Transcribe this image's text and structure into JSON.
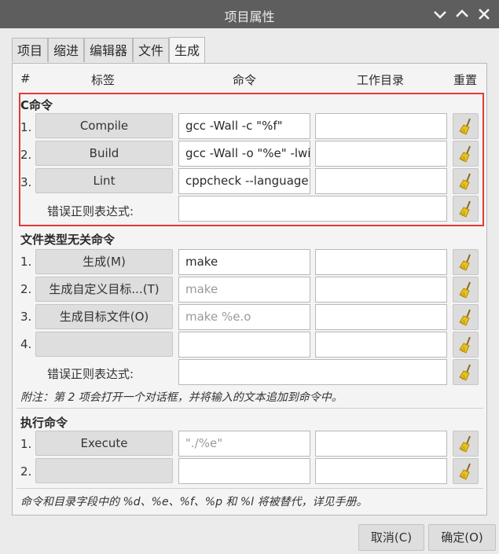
{
  "window": {
    "title": "项目属性"
  },
  "tabs": [
    "项目",
    "缩进",
    "编辑器",
    "文件",
    "生成"
  ],
  "columns": {
    "num": "#",
    "label": "标签",
    "command": "命令",
    "workdir": "工作目录",
    "reset": "重置"
  },
  "c_commands": {
    "title": "C命令",
    "rows": [
      {
        "num": "1.",
        "label": "Compile",
        "command": "gcc -Wall -c \"%f\"",
        "workdir": ""
      },
      {
        "num": "2.",
        "label": "Build",
        "command": "gcc -Wall -o \"%e\" -lwir",
        "workdir": ""
      },
      {
        "num": "3.",
        "label": "Lint",
        "command": "cppcheck --language=",
        "workdir": ""
      }
    ],
    "regex_label": "错误正则表达式:",
    "regex_value": ""
  },
  "independent_commands": {
    "title": "文件类型无关命令",
    "rows": [
      {
        "num": "1.",
        "label": "生成(M)",
        "command": "make",
        "placeholder": false,
        "workdir": ""
      },
      {
        "num": "2.",
        "label": "生成自定义目标...(T)",
        "command": "make",
        "placeholder": true,
        "workdir": ""
      },
      {
        "num": "3.",
        "label": "生成目标文件(O)",
        "command": "make %e.o",
        "placeholder": true,
        "workdir": ""
      },
      {
        "num": "4.",
        "label": "",
        "command": "",
        "placeholder": false,
        "workdir": ""
      }
    ],
    "regex_label": "错误正则表达式:",
    "regex_value": "",
    "note": "附注：第 2 项会打开一个对话框，并将输入的文本追加到命令中。"
  },
  "execute_commands": {
    "title": "执行命令",
    "rows": [
      {
        "num": "1.",
        "label": "Execute",
        "command": "\"./%e\"",
        "placeholder": true,
        "workdir": ""
      },
      {
        "num": "2.",
        "label": "",
        "command": "",
        "placeholder": false,
        "workdir": ""
      }
    ]
  },
  "footer_note": "命令和目录字段中的 %d、%e、%f、%p 和 %l 将被替代，详见手册。",
  "buttons": {
    "cancel": "取消(C)",
    "ok": "确定(O)"
  },
  "colors": {
    "titlebar": "#5e5e5e",
    "highlight": "#e53935",
    "broom": "#e8c21c"
  },
  "icons": {
    "reset": "broom-icon",
    "minimize": "chevron-down-icon",
    "maximize": "chevron-up-icon",
    "close": "close-icon"
  }
}
